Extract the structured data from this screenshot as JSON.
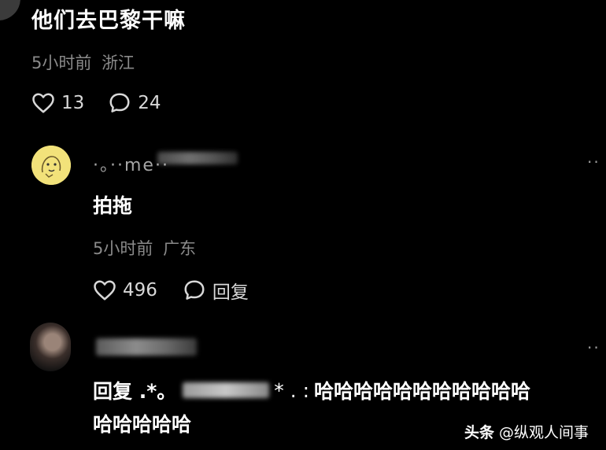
{
  "post": {
    "text": "他们去巴黎干嘛",
    "time": "5小时前",
    "location": "浙江",
    "likes": "13",
    "comments": "24"
  },
  "comment1": {
    "name_partial": "·。··me··",
    "text": "拍拖",
    "time": "5小时前",
    "location": "广东",
    "likes": "496",
    "reply_label": "回复",
    "more": "··"
  },
  "comment2": {
    "reply_prefix": "回复 .*。",
    "reply_mid": "* . :",
    "reply_text": "哈哈哈哈哈哈哈哈哈哈哈",
    "reply_text_line2": "哈哈哈哈哈",
    "more": "··"
  },
  "watermark": {
    "brand": "头条",
    "handle": "@纵观人间事"
  },
  "colors": {
    "background": "#000000",
    "meta": "#8a8a8a",
    "avatar_yellow": "#f2e27a"
  }
}
